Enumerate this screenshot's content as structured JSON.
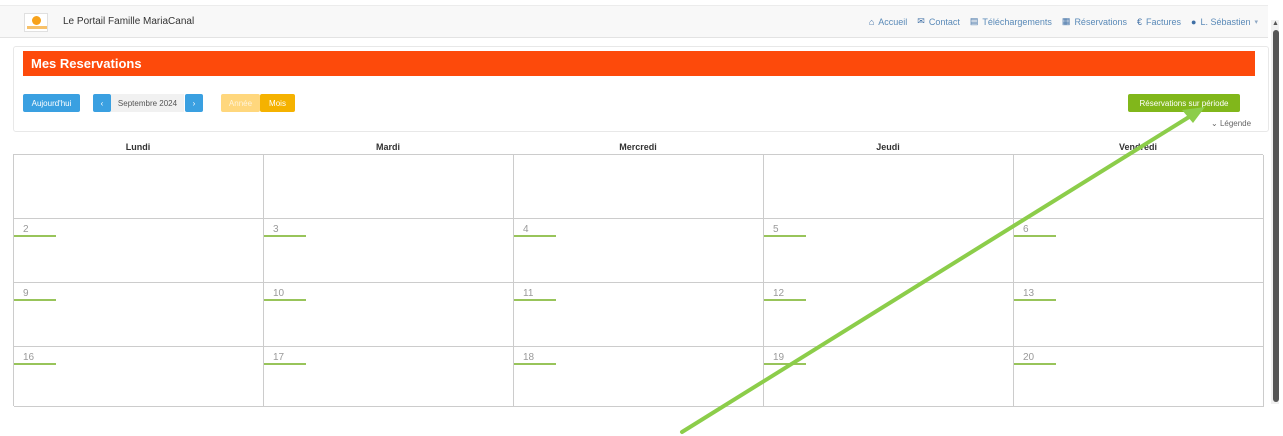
{
  "navbar": {
    "brand": "Le Portail Famille MariaCanal",
    "items": [
      {
        "icon": "home-icon",
        "glyph": "⌂",
        "label": "Accueil"
      },
      {
        "icon": "envelope-icon",
        "glyph": "✉",
        "label": "Contact"
      },
      {
        "icon": "file-icon",
        "glyph": "▤",
        "label": "Téléchargements"
      },
      {
        "icon": "calendar-icon",
        "glyph": "▦",
        "label": "Réservations"
      },
      {
        "icon": "euro-icon",
        "glyph": "€",
        "label": "Factures"
      },
      {
        "icon": "user-icon",
        "glyph": "●",
        "label": "L. Sébastien"
      }
    ]
  },
  "page": {
    "title": "Mes Reservations"
  },
  "toolbar": {
    "today": "Aujourd'hui",
    "prev": "‹",
    "next": "›",
    "month": "Septembre 2024",
    "year_view": "Année",
    "month_view": "Mois",
    "period_button": "Réservations sur période",
    "legend": "Légende"
  },
  "calendar": {
    "weekdays": [
      "Lundi",
      "Mardi",
      "Mercredi",
      "Jeudi",
      "Vendredi"
    ],
    "weeks": [
      [
        "",
        "",
        "",
        "",
        ""
      ],
      [
        "2",
        "3",
        "4",
        "5",
        "6"
      ],
      [
        "9",
        "10",
        "11",
        "12",
        "13"
      ],
      [
        "16",
        "17",
        "18",
        "19",
        "20"
      ]
    ]
  },
  "colors": {
    "title_bar": "#fd4a0b",
    "primary_button": "#3aa0e1",
    "period_button": "#81b71b",
    "day_marker": "#98c45a",
    "annotation_arrow": "#8ccd4a"
  }
}
